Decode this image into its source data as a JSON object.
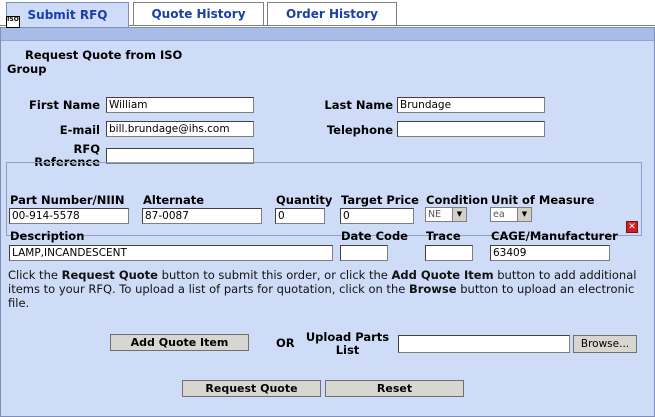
{
  "tabs": [
    {
      "label": "Submit RFQ",
      "active": true
    },
    {
      "label": "Quote History",
      "active": false
    },
    {
      "label": "Order History",
      "active": false
    }
  ],
  "header": {
    "icon": "iso-logo-icon",
    "icon_text": "ISO",
    "title": "Request Quote from ISO Group"
  },
  "contact": {
    "first_name_label": "First Name",
    "first_name_value": "William",
    "last_name_label": "Last Name",
    "last_name_value": "Brundage",
    "email_label": "E-mail",
    "email_value": "bill.brundage@ihs.com",
    "telephone_label": "Telephone",
    "telephone_value": "",
    "rfq_label_1": "RFQ",
    "rfq_label_2": "Reference",
    "rfq_value": ""
  },
  "item": {
    "part_label": "Part Number/NIIN",
    "part_value": "00-914-5578",
    "alternate_label": "Alternate",
    "alternate_value": "87-0087",
    "quantity_label": "Quantity",
    "quantity_value": "0",
    "target_price_label": "Target Price",
    "target_price_value": "0",
    "condition_label": "Condition",
    "condition_value": "NE",
    "uom_label": "Unit of Measure",
    "uom_value": "ea",
    "description_label": "Description",
    "description_value": "LAMP,INCANDESCENT",
    "date_code_label": "Date Code",
    "date_code_value": "",
    "trace_label": "Trace",
    "trace_value": "",
    "cage_label": "CAGE/Manufacturer",
    "cage_value": "63409",
    "delete_icon": "delete-x-icon"
  },
  "instructions": {
    "p1": "Click the ",
    "b1": "Request Quote",
    "p2": " button to submit this order, or click the ",
    "b2": "Add Quote Item",
    "p3": " button to add additional items to your RFQ. To upload a list of parts for quotation, click on the ",
    "b3": "Browse",
    "p4": " button to upload an electronic file."
  },
  "actions": {
    "add_quote_item": "Add Quote Item",
    "or_text": "OR",
    "upload_label_1": "Upload Parts",
    "upload_label_2": "List",
    "upload_value": "",
    "browse": "Browse...",
    "request_quote": "Request Quote",
    "reset": "Reset"
  },
  "colors": {
    "tab_text": "#1a3fa8",
    "panel_bg": "#cfdcf7",
    "panel_header": "#a7bde8",
    "delete": "#cc2222"
  }
}
